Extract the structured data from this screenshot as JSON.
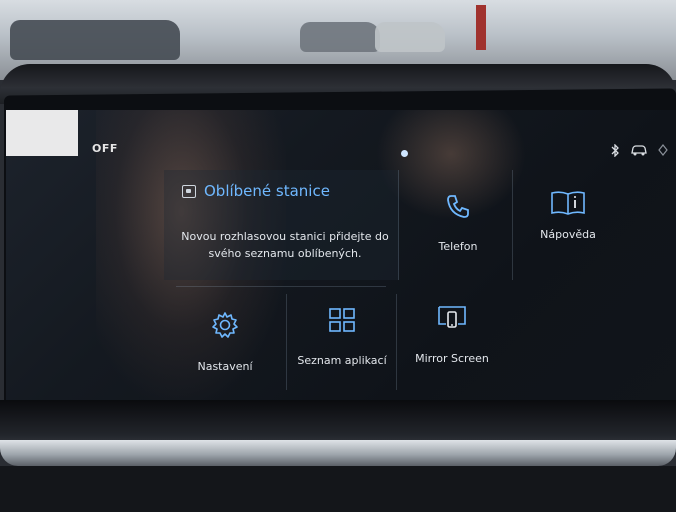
{
  "status_bar": {
    "off_label": "OFF",
    "icons": [
      "bluetooth-icon",
      "car-icon",
      "signal-icon"
    ]
  },
  "favorites": {
    "title": "Oblíbené stanice",
    "description": "Novou rozhlasovou stanici přidejte do svého seznamu oblíbených."
  },
  "tiles": {
    "phone": {
      "label": "Telefon",
      "icon": "phone-icon"
    },
    "help": {
      "label": "Nápověda",
      "icon": "book-icon"
    },
    "settings": {
      "label": "Nastavení",
      "icon": "gear-icon"
    },
    "apps": {
      "label": "Seznam aplikací",
      "icon": "grid-icon"
    },
    "mirror": {
      "label": "Mirror Screen",
      "icon": "mirror-screen-icon"
    }
  },
  "colors": {
    "accent": "#6fb8ff",
    "text": "#e7ebf0",
    "screen_bg": "#141920"
  }
}
